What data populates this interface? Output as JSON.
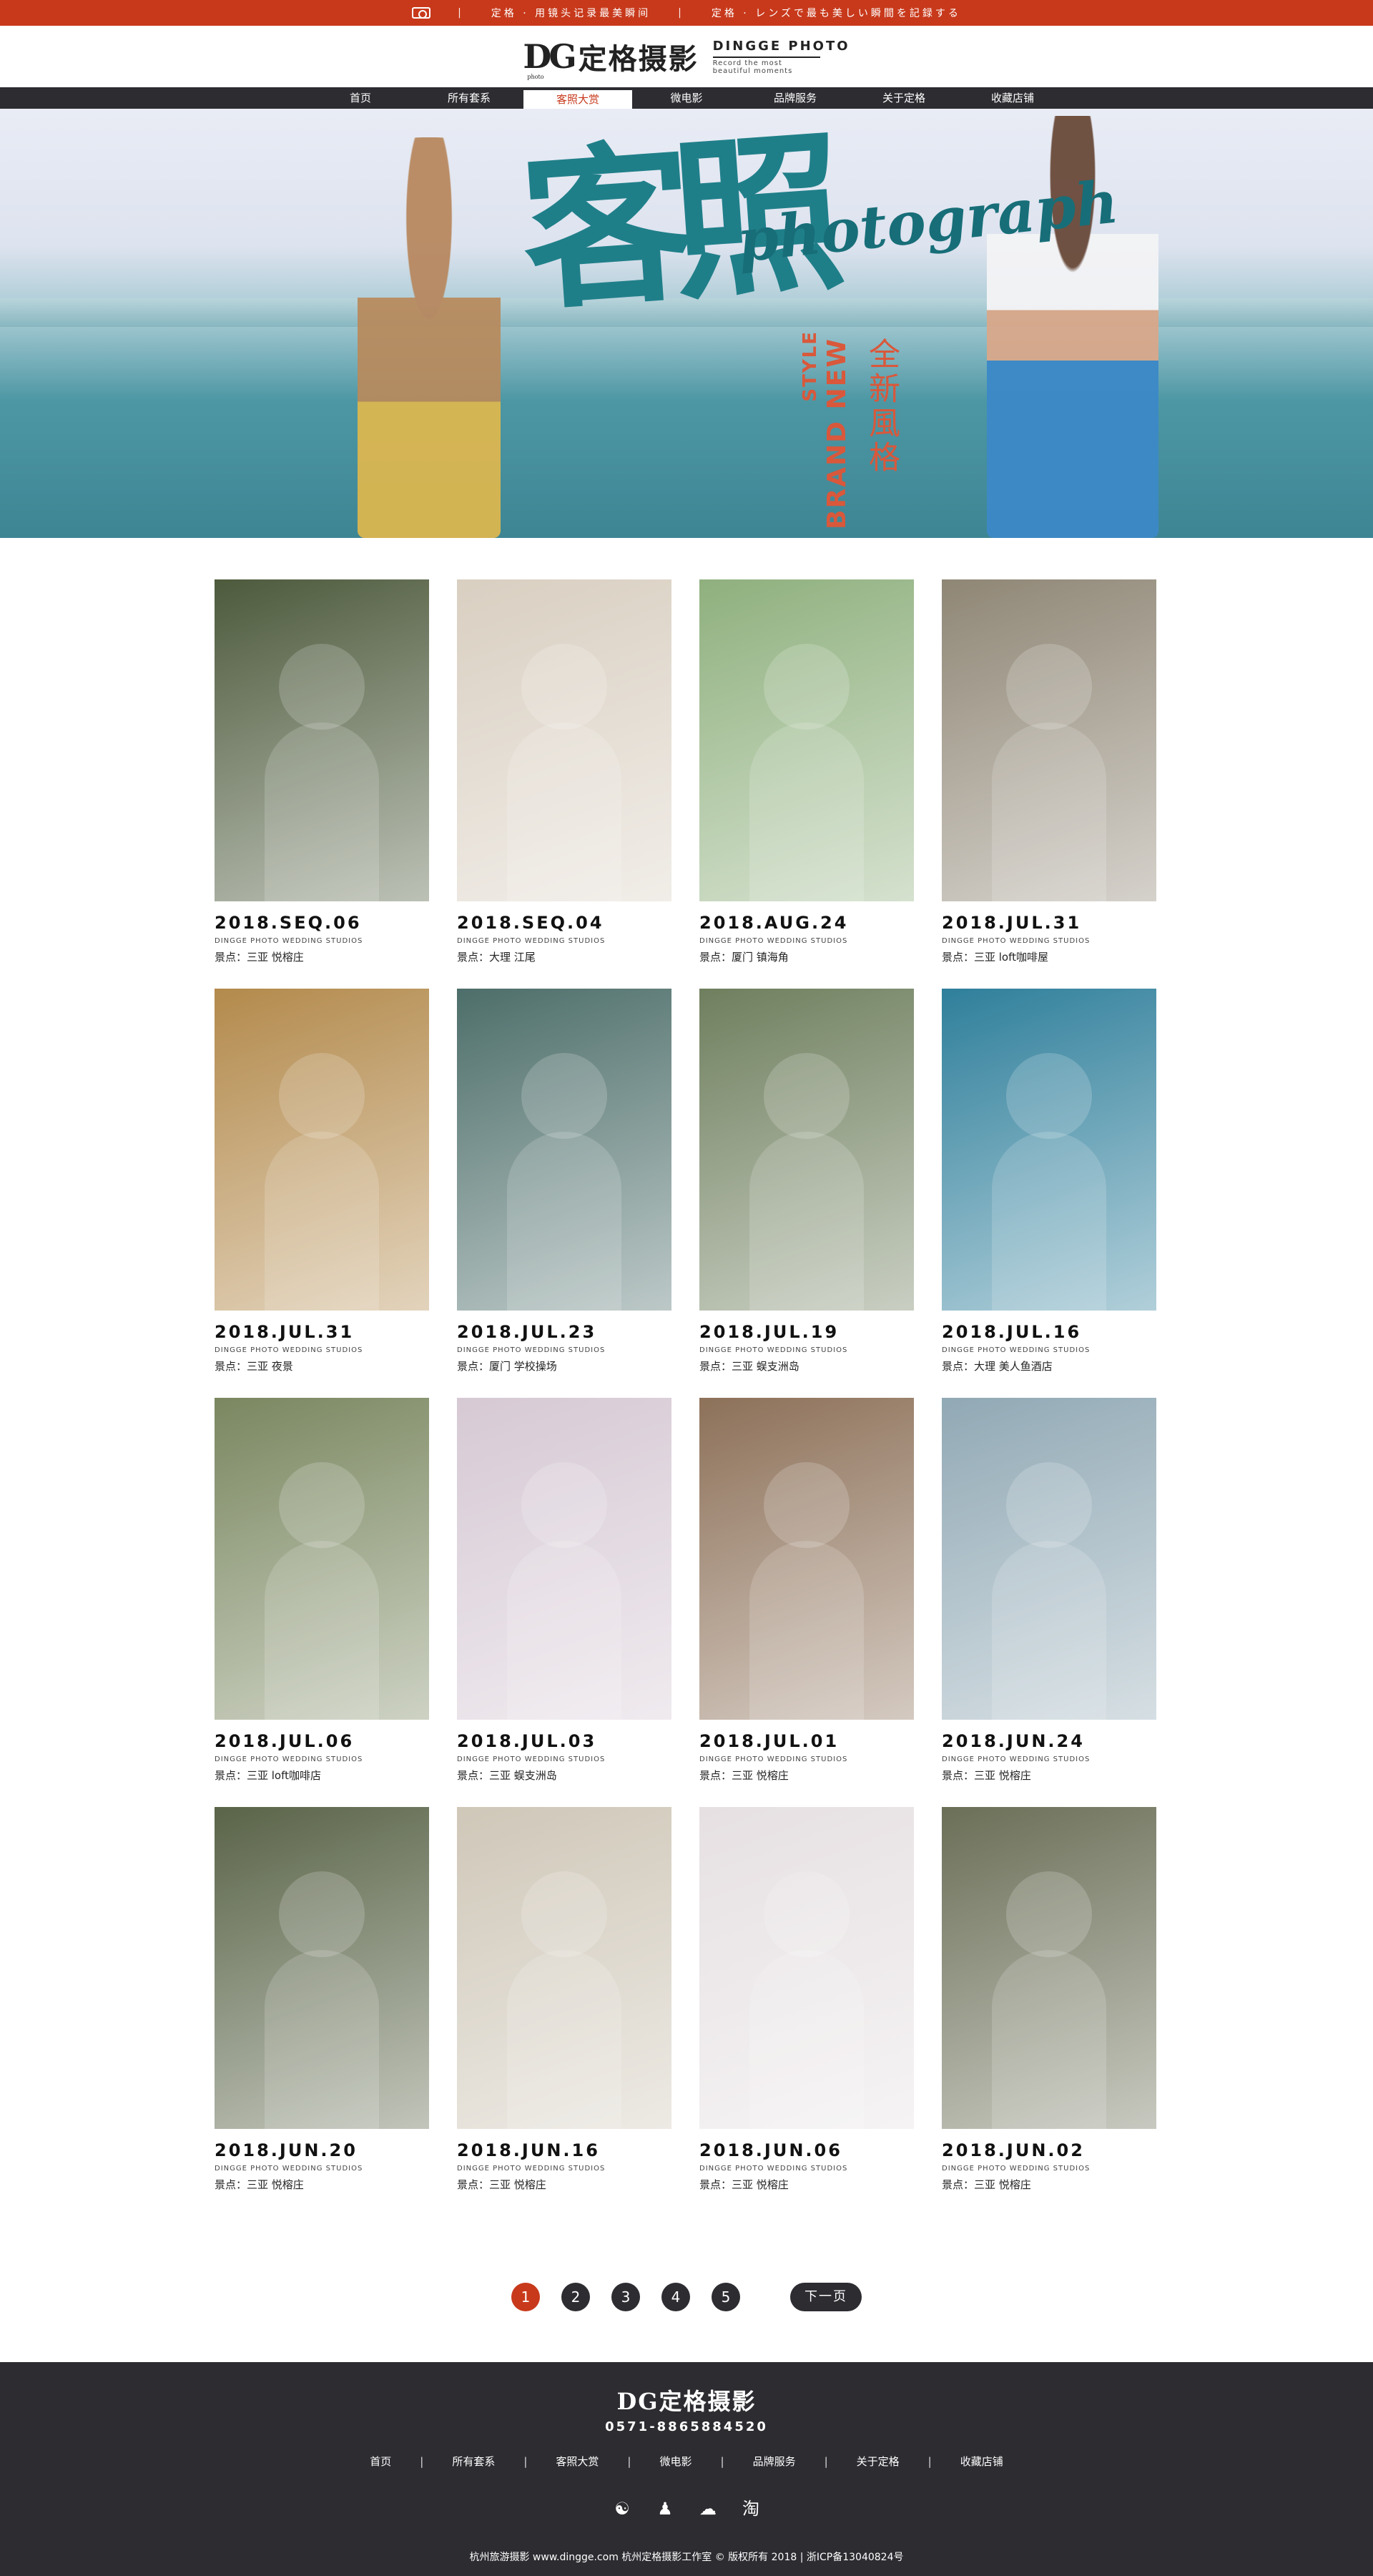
{
  "topbar": {
    "left_text": "定格 · 用镜头记录最美瞬间",
    "right_text": "定格 · レンズで最も美しい瞬間を記録する"
  },
  "brand": {
    "logo_mark": "DG",
    "logo_mark_small": "photo",
    "logo_cn": "定格摄影",
    "logo_en": "DINGGE PHOTO",
    "tagline": "Record the most beautiful moments"
  },
  "nav": {
    "items": [
      "首页",
      "所有套系",
      "客照大赏",
      "微电影",
      "品牌服务",
      "关于定格",
      "收藏店铺"
    ],
    "active_index": 2
  },
  "hero": {
    "cn_art": "客照",
    "script": "photograph",
    "style_word": "STYLE",
    "brand_new": "BRAND NEW",
    "cn_vertical": "全新風格"
  },
  "studio_line": "DINGGE PHOTO WEDDING STUDIOS",
  "gallery": [
    {
      "date": "2018.SEQ.06",
      "spot": "景点：三亚  悦榕庄",
      "color": "#4d5a3c"
    },
    {
      "date": "2018.SEQ.04",
      "spot": "景点：大理  江尾",
      "color": "#d9cfc1"
    },
    {
      "date": "2018.AUG.24",
      "spot": "景点：厦门  镇海角",
      "color": "#8fb07e"
    },
    {
      "date": "2018.JUL.31",
      "spot": "景点：三亚  loft咖啡屋",
      "color": "#8f8675"
    },
    {
      "date": "2018.JUL.31",
      "spot": "景点：三亚  夜景",
      "color": "#b38a4c"
    },
    {
      "date": "2018.JUL.23",
      "spot": "景点：厦门  学校操场",
      "color": "#4d6e6a"
    },
    {
      "date": "2018.JUL.19",
      "spot": "景点：三亚  蜈支洲岛",
      "color": "#6f7f5e"
    },
    {
      "date": "2018.JUL.16",
      "spot": "景点：大理  美人鱼酒店",
      "color": "#2f7f9b"
    },
    {
      "date": "2018.JUL.06",
      "spot": "景点：三亚  loft咖啡店",
      "color": "#7a8760"
    },
    {
      "date": "2018.JUL.03",
      "spot": "景点：三亚  蜈支洲岛",
      "color": "#d6c9d4"
    },
    {
      "date": "2018.JUL.01",
      "spot": "景点：三亚  悦榕庄",
      "color": "#8d7159"
    },
    {
      "date": "2018.JUN.24",
      "spot": "景点：三亚  悦榕庄",
      "color": "#91a9b5"
    },
    {
      "date": "2018.JUN.20",
      "spot": "景点：三亚  悦榕庄",
      "color": "#5a6448"
    },
    {
      "date": "2018.JUN.16",
      "spot": "景点：三亚  悦榕庄",
      "color": "#cfc7b8"
    },
    {
      "date": "2018.JUN.06",
      "spot": "景点：三亚  悦榕庄",
      "color": "#e6e0e2"
    },
    {
      "date": "2018.JUN.02",
      "spot": "景点：三亚  悦榕庄",
      "color": "#6b6f57"
    }
  ],
  "pager": {
    "pages": [
      "1",
      "2",
      "3",
      "4",
      "5"
    ],
    "current": "1",
    "next_label": "下一页"
  },
  "footer": {
    "logo": "DG定格摄影",
    "phone": "0571-8865884520",
    "links": [
      "首页",
      "所有套系",
      "客照大赏",
      "微电影",
      "品牌服务",
      "关于定格",
      "收藏店铺"
    ],
    "separator": "|",
    "icons": [
      {
        "name": "weibo-icon",
        "glyph": "☯"
      },
      {
        "name": "qq-icon",
        "glyph": "♟"
      },
      {
        "name": "wechat-icon",
        "glyph": "☁"
      },
      {
        "name": "taobao-icon",
        "glyph": "淘"
      }
    ],
    "copyright": "杭州旅游摄影 www.dingge.com 杭州定格摄影工作室 © 版权所有 2018 | 浙ICP备13040824号"
  },
  "colors": {
    "accent": "#c8391b",
    "dark": "#2c2c31"
  }
}
